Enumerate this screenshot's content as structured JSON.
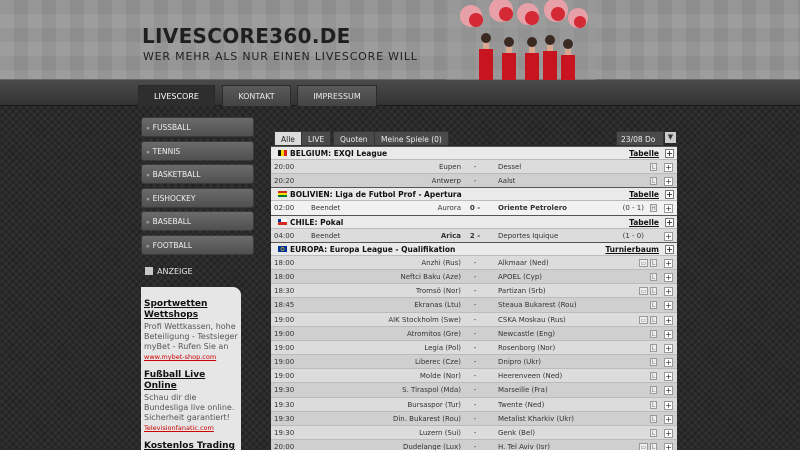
{
  "header": {
    "title": "LIVESCORE360.DE",
    "subtitle": "WER MEHR ALS NUR EINEN LIVESCORE WILL"
  },
  "nav": {
    "tabs": [
      {
        "label": "LIVESCORE",
        "active": true
      },
      {
        "label": "KONTAKT",
        "active": false
      },
      {
        "label": "IMPRESSUM",
        "active": false
      }
    ]
  },
  "sidebar": {
    "items": [
      "FUSSBALL",
      "TENNIS",
      "BASKETBALL",
      "EISHOCKEY",
      "BASEBALL",
      "FOOTBALL"
    ]
  },
  "ads": {
    "label": "ANZEIGE",
    "blocks": [
      {
        "title": "Sportwetten Wettshops",
        "text": "Profi Wettkassen, hohe Beteiligung - Testsieger myBet - Rufen Sie an",
        "url": "www.mybet-shop.com"
      },
      {
        "title": "Fußball Live Online",
        "text": "Schau dir die Bundesliga live online. Sicherheit garantiert!",
        "url": "Televisionfanatic.com"
      },
      {
        "title": "Kostenlos Trading",
        "text": "",
        "url": ""
      }
    ]
  },
  "filters": {
    "tabs": [
      "Alle",
      "LIVE",
      "Quoten",
      "Meine Spiele (0)"
    ],
    "date": "23/08 Do",
    "date_button": "▼"
  },
  "leagues": {
    "belgium": {
      "name": "BELGIUM: EXQI League",
      "link": "Tabelle",
      "flag_colors": [
        "#111111",
        "#f5d800",
        "#e0201b"
      ]
    },
    "bolivia": {
      "name": "BOLIVIEN: Liga de Futbol Prof - Apertura",
      "link": "Tabelle",
      "flag_colors": [
        "#d52b1e",
        "#f9e300",
        "#007934"
      ]
    },
    "chile": {
      "name": "CHILE: Pokal",
      "link": "Tabelle",
      "flag_colors": [
        "#ffffff",
        "#d52b1e",
        "#0039a6"
      ]
    },
    "europe": {
      "name": "EUROPA: Europa League - Qualifikation",
      "link": "Turnierbaum",
      "flag_colors": [
        "#003399",
        "#ffcc00"
      ]
    }
  },
  "matches": {
    "belgium": [
      {
        "time": "20:00",
        "status": "",
        "home": "Eupen",
        "sep": "-",
        "away": "Dessel"
      },
      {
        "time": "20:20",
        "status": "",
        "home": "Antwerp",
        "sep": "-",
        "away": "Aalst"
      }
    ],
    "bolivia": [
      {
        "time": "02:00",
        "status": "Beendet",
        "home": "Aurora",
        "sep": "0 - 2",
        "away": "Oriente Petrolero",
        "half": "(0 - 1)"
      }
    ],
    "chile": [
      {
        "time": "04:00",
        "status": "Beendet",
        "home": "Arica",
        "sep": "2 - 1",
        "away": "Deportes Iquique",
        "half": "(1 - 0)"
      }
    ],
    "europe": [
      {
        "time": "18:00",
        "home": "Anzhi (Rus)",
        "sep": "-",
        "away": "Alkmaar (Ned)"
      },
      {
        "time": "18:00",
        "home": "Neftci Baku (Aze)",
        "sep": "-",
        "away": "APOEL (Cyp)"
      },
      {
        "time": "18:30",
        "home": "Tromsö (Nor)",
        "sep": "-",
        "away": "Partizan (Srb)"
      },
      {
        "time": "18:45",
        "home": "Ekranas (Ltu)",
        "sep": "-",
        "away": "Steaua Bukarest (Rou)"
      },
      {
        "time": "19:00",
        "home": "AIK Stockholm (Swe)",
        "sep": "-",
        "away": "CSKA Moskau (Rus)"
      },
      {
        "time": "19:00",
        "home": "Atromitos (Gre)",
        "sep": "-",
        "away": "Newcastle (Eng)"
      },
      {
        "time": "19:00",
        "home": "Legia (Pol)",
        "sep": "-",
        "away": "Rosenborg (Nor)"
      },
      {
        "time": "19:00",
        "home": "Liberec (Cze)",
        "sep": "-",
        "away": "Dnipro (Ukr)"
      },
      {
        "time": "19:00",
        "home": "Molde (Nor)",
        "sep": "-",
        "away": "Heerenveen (Ned)"
      },
      {
        "time": "19:30",
        "home": "S. Tiraspol (Mda)",
        "sep": "-",
        "away": "Marseille (Fra)"
      },
      {
        "time": "19:30",
        "home": "Bursaspor (Tur)",
        "sep": "-",
        "away": "Twente (Ned)"
      },
      {
        "time": "19:30",
        "home": "Din. Bukarest (Rou)",
        "sep": "-",
        "away": "Metalist Kharkiv (Ukr)"
      },
      {
        "time": "19:30",
        "home": "Luzern (Sui)",
        "sep": "-",
        "away": "Genk (Bel)"
      },
      {
        "time": "20:00",
        "home": "Dudelange (Lux)",
        "sep": "-",
        "away": "H. Tel Aviv (Isr)"
      }
    ]
  },
  "row_icons": {
    "tv": "▭",
    "lineup": "L",
    "expand": "+",
    "h": "H"
  }
}
